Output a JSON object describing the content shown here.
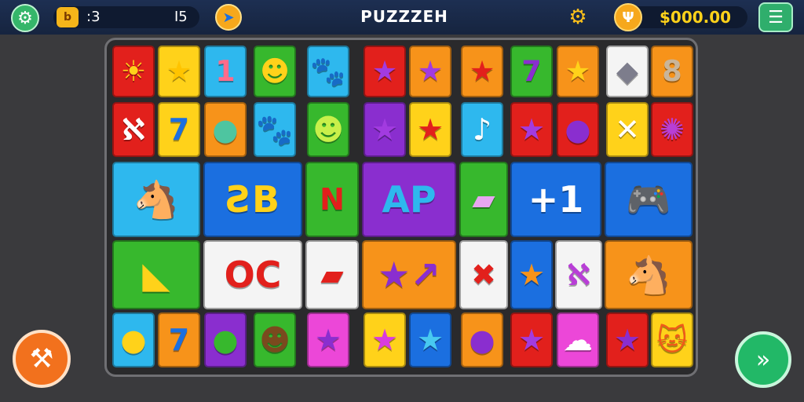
{
  "header": {
    "title": "PUZZZEH",
    "gems": ":3",
    "moves": "I5",
    "coins": "$000.00"
  },
  "colors": {
    "red": "#e2201c",
    "yellow": "#ffd21a",
    "cyan": "#2eb8ee",
    "green": "#37b82d",
    "blue": "#1b6fe0",
    "purple": "#8a2ecf",
    "orange": "#f7931a",
    "white": "#f4f4f4",
    "magenta": "#ec47d8"
  },
  "icons": {
    "settings": "gear-icon",
    "gems": "gem-icon",
    "hint": "arrow-icon",
    "sun": "sun-gear-icon",
    "coin": "coin-icon",
    "menu": "menu-icon",
    "hammer": "hammer-icon",
    "next": "fast-forward-icon"
  },
  "tiles": [
    {
      "name": "sun-creature",
      "bg": "red",
      "glyph": "☀",
      "fg": "#ffd21a"
    },
    {
      "name": "star",
      "bg": "yellow",
      "glyph": "★",
      "fg": "#ffc400"
    },
    {
      "name": "number-one",
      "bg": "cyan",
      "glyph": "1",
      "fg": "#ff6b8a"
    },
    {
      "name": "frog",
      "bg": "green",
      "glyph": "☻",
      "fg": "#ffd21a"
    },
    {
      "name": "creature",
      "bg": "cyan",
      "glyph": "🐾",
      "fg": "#7a4a1e"
    },
    {
      "name": "star",
      "bg": "red",
      "glyph": "★",
      "fg": "#a23be0"
    },
    {
      "name": "star",
      "bg": "orange",
      "glyph": "★",
      "fg": "#a23be0"
    },
    {
      "name": "star",
      "bg": "orange",
      "glyph": "★",
      "fg": "#e2201c"
    },
    {
      "name": "number-seven",
      "bg": "green",
      "glyph": "7",
      "fg": "#8a2ecf"
    },
    {
      "name": "star",
      "bg": "orange",
      "glyph": "★",
      "fg": "#ffd21a"
    },
    {
      "name": "gadget",
      "bg": "white",
      "glyph": "◆",
      "fg": "#7d7d8c"
    },
    {
      "name": "bone",
      "bg": "orange",
      "glyph": "8",
      "fg": "#c9b59a"
    },
    {
      "name": "ribbon",
      "bg": "red",
      "glyph": "ℵ",
      "fg": "#ffffff"
    },
    {
      "name": "number-seven",
      "bg": "yellow",
      "glyph": "7",
      "fg": "#1b6fe0"
    },
    {
      "name": "paddle",
      "bg": "orange",
      "glyph": "●",
      "fg": "#4ec5a0"
    },
    {
      "name": "otter",
      "bg": "cyan",
      "glyph": "🐾",
      "fg": "#7a4a1e"
    },
    {
      "name": "bunny",
      "bg": "green",
      "glyph": "☻",
      "fg": "#c8f04a"
    },
    {
      "name": "star",
      "bg": "purple",
      "glyph": "★",
      "fg": "#a23be0"
    },
    {
      "name": "star",
      "bg": "yellow",
      "glyph": "★",
      "fg": "#e2201c"
    },
    {
      "name": "music-note",
      "bg": "cyan",
      "glyph": "♪",
      "fg": "#ffffff"
    },
    {
      "name": "star",
      "bg": "red",
      "glyph": "★",
      "fg": "#a23be0"
    },
    {
      "name": "drumstick",
      "bg": "red",
      "glyph": "●",
      "fg": "#8a2ecf"
    },
    {
      "name": "cross",
      "bg": "yellow",
      "glyph": "✕",
      "fg": "#ffffff"
    },
    {
      "name": "flower",
      "bg": "red",
      "glyph": "✺",
      "fg": "#b83ed6"
    },
    {
      "name": "pegasus",
      "bg": "cyan",
      "glyph": "🐴",
      "fg": "#ffd21a",
      "big": 1
    },
    {
      "name": "letter-b",
      "bg": "blue",
      "glyph": "ƧB",
      "fg": "#ffd21a",
      "big": 1
    },
    {
      "name": "letter-n",
      "bg": "green",
      "glyph": "N",
      "fg": "#e2201c"
    },
    {
      "name": "letter-ap",
      "bg": "purple",
      "glyph": "AP",
      "fg": "#2eb8ee",
      "big": 1
    },
    {
      "name": "eraser",
      "bg": "green",
      "glyph": "▰",
      "fg": "#e7a6f0"
    },
    {
      "name": "plus-one",
      "bg": "blue",
      "glyph": "+1",
      "fg": "#ffffff",
      "big": 1
    },
    {
      "name": "gamepad",
      "bg": "blue",
      "glyph": "🎮",
      "fg": "#ffffff",
      "big": 1
    },
    {
      "name": "dinosaur",
      "bg": "green",
      "glyph": "◣",
      "fg": "#ffd21a",
      "big": 1
    },
    {
      "name": "letter-oc",
      "bg": "white",
      "glyph": "OC",
      "fg": "#e2201c",
      "big": 1
    },
    {
      "name": "pill",
      "bg": "white",
      "glyph": "▰",
      "fg": "#e2201c"
    },
    {
      "name": "star-arrow",
      "bg": "orange",
      "glyph": "★↗",
      "fg": "#8a2ecf",
      "big": 1
    },
    {
      "name": "cross",
      "bg": "white",
      "glyph": "✖",
      "fg": "#e2201c"
    },
    {
      "name": "star",
      "bg": "blue",
      "glyph": "★",
      "fg": "#f7931a"
    },
    {
      "name": "heart-ribbon",
      "bg": "white",
      "glyph": "ℵ",
      "fg": "#b83ed6"
    },
    {
      "name": "pegasus",
      "bg": "orange",
      "glyph": "🐴",
      "fg": "#ffd21a",
      "big": 1
    },
    {
      "name": "racket",
      "bg": "cyan",
      "glyph": "●",
      "fg": "#ffd21a"
    },
    {
      "name": "number-seven",
      "bg": "orange",
      "glyph": "7",
      "fg": "#1b6fe0"
    },
    {
      "name": "paddle",
      "bg": "purple",
      "glyph": "●",
      "fg": "#37b82d"
    },
    {
      "name": "owl",
      "bg": "green",
      "glyph": "☻",
      "fg": "#7a4a1e"
    },
    {
      "name": "star",
      "bg": "magenta",
      "glyph": "★",
      "fg": "#8a2ecf"
    },
    {
      "name": "star",
      "bg": "yellow",
      "glyph": "★",
      "fg": "#d93ce0"
    },
    {
      "name": "star",
      "bg": "blue",
      "glyph": "★",
      "fg": "#48c9f0"
    },
    {
      "name": "drumstick",
      "bg": "orange",
      "glyph": "●",
      "fg": "#8a2ecf"
    },
    {
      "name": "star",
      "bg": "red",
      "glyph": "★",
      "fg": "#a23be0"
    },
    {
      "name": "ghost",
      "bg": "magenta",
      "glyph": "☁",
      "fg": "#ffffff"
    },
    {
      "name": "star",
      "bg": "red",
      "glyph": "★",
      "fg": "#8a2ecf"
    },
    {
      "name": "cat",
      "bg": "yellow",
      "glyph": "🐱",
      "fg": "#ef5a1a"
    }
  ]
}
